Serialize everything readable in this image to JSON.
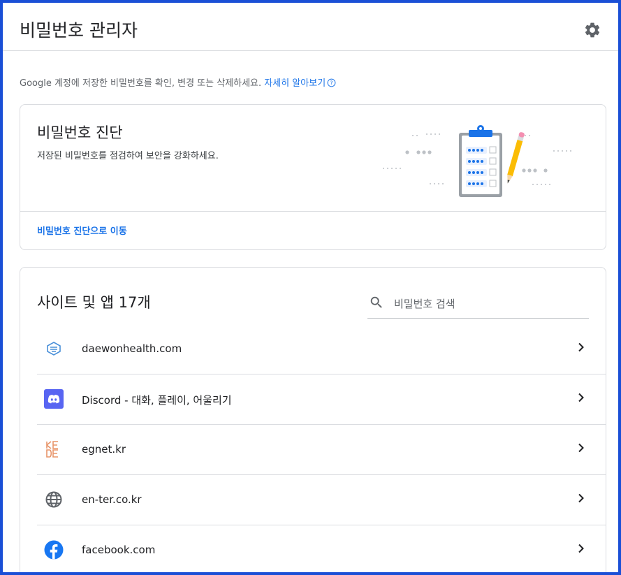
{
  "header": {
    "title": "비밀번호 관리자",
    "settings_icon": "gear-icon"
  },
  "intro": {
    "text": "Google 계정에 저장한 비밀번호를 확인, 변경 또는 삭제하세요.",
    "link": "자세히 알아보기"
  },
  "checkup": {
    "title": "비밀번호 진단",
    "description": "저장된 비밀번호를 점검하여 보안을 강화하세요.",
    "link": "비밀번호 진단으로 이동"
  },
  "sites": {
    "title": "사이트 및 앱 17개",
    "search_placeholder": "비밀번호 검색",
    "items": [
      {
        "name": "daewonhealth.com",
        "icon": "daewonhealth-favicon"
      },
      {
        "name": "Discord - 대화, 플레이, 어울리기",
        "icon": "discord-icon"
      },
      {
        "name": "egnet.kr",
        "icon": "kede-logo"
      },
      {
        "name": "en-ter.co.kr",
        "icon": "globe-icon"
      },
      {
        "name": "facebook.com",
        "icon": "facebook-icon"
      }
    ]
  },
  "colors": {
    "accent": "#1a73e8",
    "frame_border": "#1a4fd6",
    "divider": "#dadce0"
  }
}
